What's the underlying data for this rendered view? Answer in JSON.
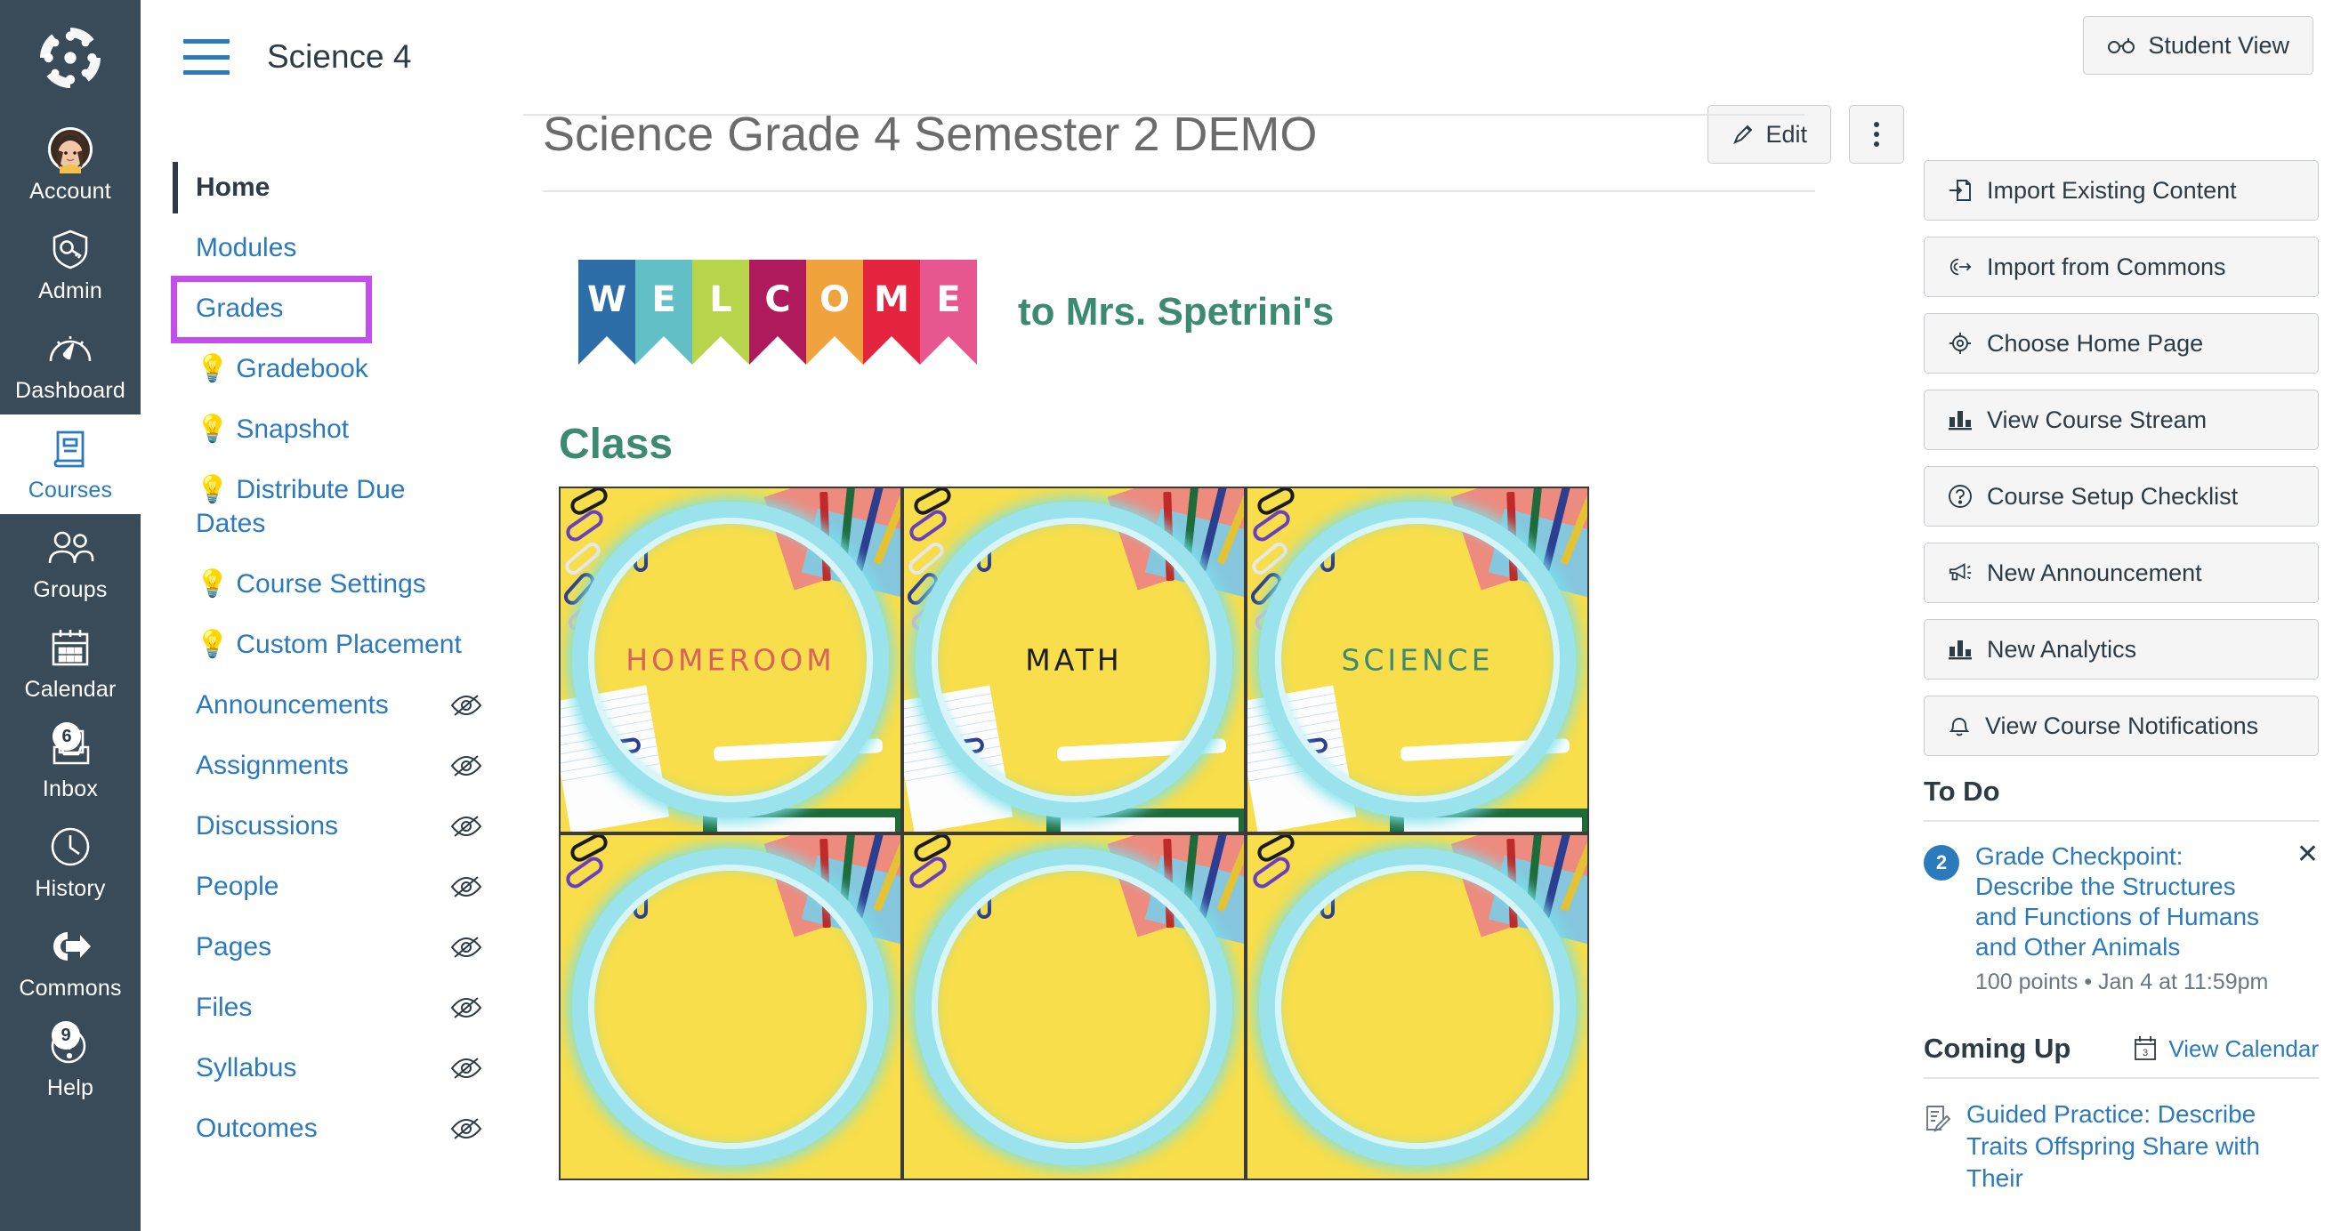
{
  "global_nav": {
    "logo": "canvas-logo",
    "items": [
      {
        "label": "Account",
        "icon": "avatar-icon",
        "active": false,
        "badge": null
      },
      {
        "label": "Admin",
        "icon": "shield-key-icon",
        "active": false,
        "badge": null
      },
      {
        "label": "Dashboard",
        "icon": "speedometer-icon",
        "active": false,
        "badge": null
      },
      {
        "label": "Courses",
        "icon": "book-icon",
        "active": true,
        "badge": null
      },
      {
        "label": "Groups",
        "icon": "people-icon",
        "active": false,
        "badge": null
      },
      {
        "label": "Calendar",
        "icon": "calendar-icon",
        "active": false,
        "badge": null
      },
      {
        "label": "Inbox",
        "icon": "inbox-icon",
        "active": false,
        "badge": "6"
      },
      {
        "label": "History",
        "icon": "clock-icon",
        "active": false,
        "badge": null
      },
      {
        "label": "Commons",
        "icon": "commons-arrow-icon",
        "active": false,
        "badge": null
      },
      {
        "label": "Help",
        "icon": "question-circle-icon",
        "active": false,
        "badge": "9"
      }
    ]
  },
  "topbar": {
    "menu_icon": "hamburger-icon",
    "course_code": "Science 4",
    "student_view_label": "Student View",
    "student_view_icon": "eyeglasses-icon"
  },
  "course_nav": {
    "items": [
      {
        "label": "Home",
        "home": true,
        "bulb": false,
        "hidden": false,
        "highlight": false
      },
      {
        "label": "Modules",
        "home": false,
        "bulb": false,
        "hidden": false,
        "highlight": false
      },
      {
        "label": "Grades",
        "home": false,
        "bulb": false,
        "hidden": false,
        "highlight": true
      },
      {
        "label": "Gradebook",
        "home": false,
        "bulb": true,
        "hidden": false,
        "highlight": false
      },
      {
        "label": "Snapshot",
        "home": false,
        "bulb": true,
        "hidden": false,
        "highlight": false
      },
      {
        "label": "Distribute Due Dates",
        "home": false,
        "bulb": true,
        "hidden": false,
        "highlight": false
      },
      {
        "label": "Course Settings",
        "home": false,
        "bulb": true,
        "hidden": false,
        "highlight": false
      },
      {
        "label": "Custom Placement",
        "home": false,
        "bulb": true,
        "hidden": false,
        "highlight": false
      },
      {
        "label": "Announcements",
        "home": false,
        "bulb": false,
        "hidden": true,
        "highlight": false
      },
      {
        "label": "Assignments",
        "home": false,
        "bulb": false,
        "hidden": true,
        "highlight": false
      },
      {
        "label": "Discussions",
        "home": false,
        "bulb": false,
        "hidden": true,
        "highlight": false
      },
      {
        "label": "People",
        "home": false,
        "bulb": false,
        "hidden": true,
        "highlight": false
      },
      {
        "label": "Pages",
        "home": false,
        "bulb": false,
        "hidden": true,
        "highlight": false
      },
      {
        "label": "Files",
        "home": false,
        "bulb": false,
        "hidden": true,
        "highlight": false
      },
      {
        "label": "Syllabus",
        "home": false,
        "bulb": false,
        "hidden": true,
        "highlight": false
      },
      {
        "label": "Outcomes",
        "home": false,
        "bulb": false,
        "hidden": true,
        "highlight": false
      }
    ],
    "highlight_color": "#C44DEB",
    "bulb_glyph": "💡",
    "hidden_icon": "eye-off-icon"
  },
  "main": {
    "page_title": "Science Grade 4 Semester 2 DEMO",
    "edit_label": "Edit",
    "edit_icon": "pencil-icon",
    "kebab_icon": "more-vertical-icon",
    "welcome": {
      "letters": [
        {
          "char": "W",
          "color": "#2D6DA8"
        },
        {
          "char": "E",
          "color": "#62BFC6"
        },
        {
          "char": "L",
          "color": "#B8D44A"
        },
        {
          "char": "C",
          "color": "#AE1A5B"
        },
        {
          "char": "O",
          "color": "#F0A23C"
        },
        {
          "char": "M",
          "color": "#E5243F"
        },
        {
          "char": "E",
          "color": "#E8568F"
        }
      ],
      "suffix_text": "to Mrs. Spetrini's",
      "text_color": "#3C8A72"
    },
    "section_heading": "Class",
    "section_heading_color": "#3C8A72",
    "cards": [
      {
        "label": "HOMEROOM",
        "color": "#D9615E"
      },
      {
        "label": "MATH",
        "color": "#1E1E1E"
      },
      {
        "label": "SCIENCE",
        "color": "#3C8A72"
      },
      {
        "label": "",
        "color": "#1E1E1E"
      },
      {
        "label": "",
        "color": "#1E1E1E"
      },
      {
        "label": "",
        "color": "#1E1E1E"
      }
    ]
  },
  "sidebar": {
    "buttons": [
      {
        "label": "Import Existing Content",
        "icon": "import-document-icon"
      },
      {
        "label": "Import from Commons",
        "icon": "commons-arrow-icon"
      },
      {
        "label": "Choose Home Page",
        "icon": "target-icon"
      },
      {
        "label": "View Course Stream",
        "icon": "bar-chart-icon"
      },
      {
        "label": "Course Setup Checklist",
        "icon": "question-circle-icon"
      },
      {
        "label": "New Announcement",
        "icon": "megaphone-icon"
      },
      {
        "label": "New Analytics",
        "icon": "bar-chart-icon"
      },
      {
        "label": "View Course Notifications",
        "icon": "bell-icon"
      }
    ],
    "todo": {
      "heading": "To Do",
      "items": [
        {
          "badge": "2",
          "title": "Grade Checkpoint: Describe the Structures and Functions of Humans and Other Animals",
          "meta": "100 points • Jan 4 at 11:59pm",
          "dismiss_icon": "close-icon"
        }
      ]
    },
    "coming_up": {
      "heading": "Coming Up",
      "view_calendar_label": "View Calendar",
      "view_calendar_icon": "calendar-icon",
      "items": [
        {
          "icon": "assignment-icon",
          "title": "Guided Practice: Describe Traits Offspring Share with Their"
        }
      ]
    }
  }
}
